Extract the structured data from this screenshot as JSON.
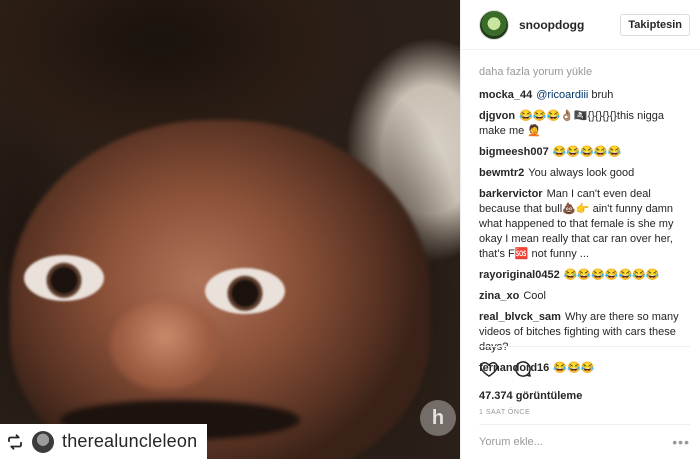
{
  "post": {
    "username": "snoopdogg",
    "follow_label": "Takiptesin",
    "repost_username": "therealuncleleon",
    "watermark": "h"
  },
  "comments": {
    "load_more": "daha fazla yorum yükle",
    "items": [
      {
        "user": "mocka_44",
        "mention": "@ricoardiii",
        "text": " bruh"
      },
      {
        "user": "djgvon",
        "mention": "",
        "text": "😂😂😂👌🏽🏴‍☠️{}{}{}{}this nigga make me 🤦"
      },
      {
        "user": "bigmeesh007",
        "mention": "",
        "text": "😂😂😂😂😂"
      },
      {
        "user": "bewmtr2",
        "mention": "",
        "text": "You always look good"
      },
      {
        "user": "barkervictor",
        "mention": "",
        "text": "Man I can't even deal because that bull💩👉 ain't funny damn what happened to that female is she my okay I mean really that car ran over her, that's F🆘 not funny ..."
      },
      {
        "user": "rayoriginal0452",
        "mention": "",
        "text": "😂😂😂😂😂😂😂"
      },
      {
        "user": "zina_xo",
        "mention": "",
        "text": "Cool"
      },
      {
        "user": "real_blvck_sam",
        "mention": "",
        "text": "Why are there so many videos of bitches fighting with cars these days?"
      },
      {
        "user": "fernandord16",
        "mention": "",
        "text": "😂😂😂"
      }
    ]
  },
  "actions": {
    "icons": [
      "heart-icon",
      "comment-icon"
    ],
    "views": "47.374 görüntüleme",
    "time": "1 SAAT ÖNCE"
  },
  "comment_box": {
    "placeholder": "Yorum ekle...",
    "more": "•••"
  }
}
